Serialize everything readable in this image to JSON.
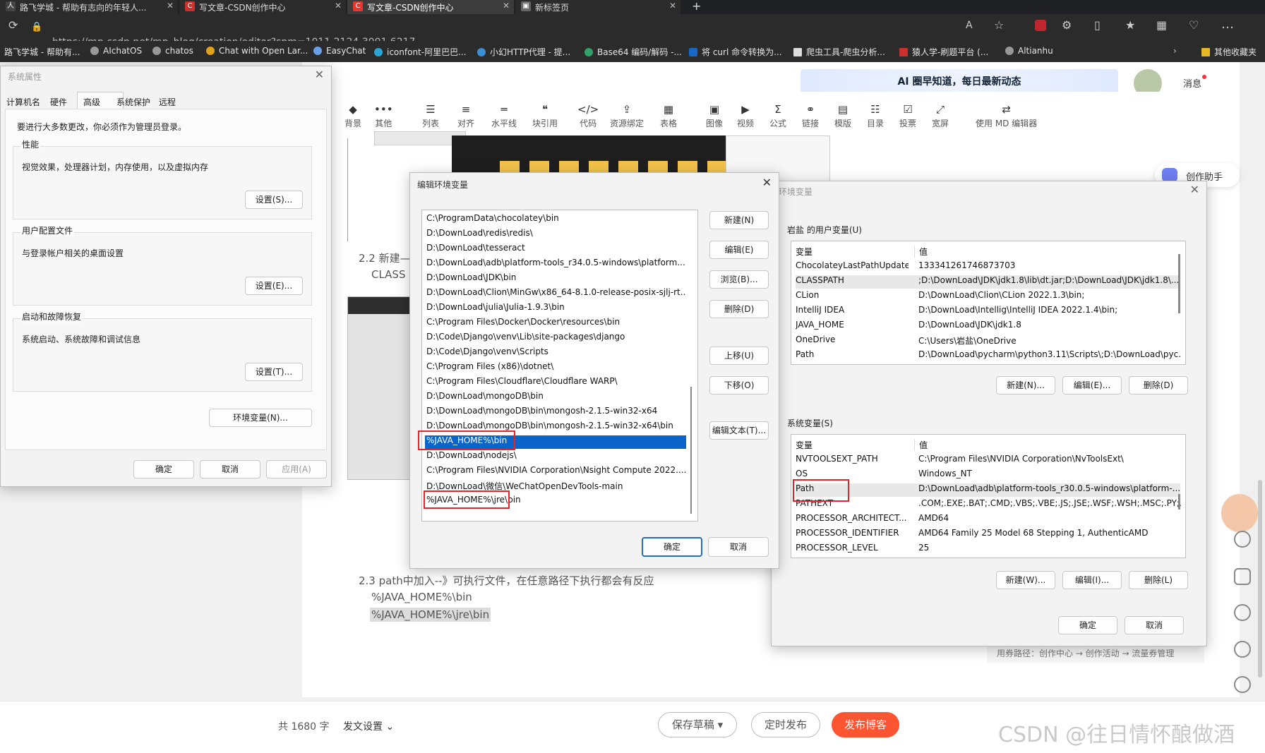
{
  "browser": {
    "tabs": [
      {
        "title": "路飞学城 - 帮助有志向的年轻人..."
      },
      {
        "title": "写文章-CSDN创作中心"
      },
      {
        "title": "写文章-CSDN创作中心"
      },
      {
        "title": "新标签页"
      }
    ],
    "url": "https://mp.csdn.net/mp_blog/creation/editor?spm=1011.2124.3001.6217",
    "bookmarks": [
      "路飞学城 - 帮助有...",
      "AIchatOS",
      "chatos",
      "Chat with Open Lar...",
      "EasyChat",
      "iconfont-阿里巴巴...",
      "小幻HTTP代理 - 提...",
      "Base64 编码/解码 -...",
      "将 curl 命令转换为...",
      "爬虫工具-爬虫分析...",
      "猿人学-刷题平台 (...",
      "Altianhu"
    ],
    "other_bookmarks": "其他收藏夹"
  },
  "editor": {
    "toolbar": [
      "背景",
      "其他",
      "列表",
      "对齐",
      "水平线",
      "块引用",
      "代码",
      "资源绑定",
      "表格",
      "图像",
      "视频",
      "公式",
      "链接",
      "模版",
      "目录",
      "投票",
      "宽屏",
      "使用 MD 编辑器"
    ],
    "banner": "AI 圈早知道，每日最新动态",
    "message_label": "消息",
    "assistant": "创作助手",
    "section_22": "2.2 新建—",
    "classpath_text": "CLASS",
    "section_23": "2.3 path中加入--》可执行文件，在任意路径下执行都会有反应",
    "line1": "%JAVA_HOME%\\bin",
    "line2": "%JAVA_HOME%\\jre\\bin",
    "usage_path": "用券路径：创作中心 → 创作活动 → 流量券管理",
    "word_count": "共 1680 字",
    "publish_settings": "发文设置",
    "save_draft": "保存草稿",
    "scheduled": "定时发布",
    "publish": "发布博客",
    "watermark": "CSDN @往日情怀酿做酒"
  },
  "sysprops": {
    "title": "系统属性",
    "tabs": [
      "计算机名",
      "硬件",
      "高级",
      "系统保护",
      "远程"
    ],
    "admin_note": "要进行大多数更改，你必须作为管理员登录。",
    "perf_label": "性能",
    "perf_desc": "视觉效果，处理器计划，内存使用，以及虚拟内存",
    "perf_btn": "设置(S)...",
    "profile_label": "用户配置文件",
    "profile_desc": "与登录帐户相关的桌面设置",
    "profile_btn": "设置(E)...",
    "startup_label": "启动和故障恢复",
    "startup_desc": "系统启动、系统故障和调试信息",
    "startup_btn": "设置(T)...",
    "envvars_btn": "环境变量(N)...",
    "ok": "确定",
    "cancel": "取消",
    "apply": "应用(A)"
  },
  "editenv": {
    "title": "编辑环境变量",
    "items": [
      "C:\\ProgramData\\chocolatey\\bin",
      "D:\\DownLoad\\redis\\redis\\",
      "D:\\DownLoad\\tesseract",
      "D:\\DownLoad\\adb\\platform-tools_r34.0.5-windows\\platform...",
      "D:\\DownLoad\\JDK\\bin",
      "D:\\DownLoad\\Clion\\MinGw\\x86_64-8.1.0-release-posix-sjlj-rt...",
      "D:\\DownLoad\\julia\\Julia-1.9.3\\bin",
      "C:\\Program Files\\Docker\\Docker\\resources\\bin",
      "D:\\Code\\Django\\venv\\Lib\\site-packages\\django",
      "D:\\Code\\Django\\venv\\Scripts",
      "C:\\Program Files (x86)\\dotnet\\",
      "C:\\Program Files\\Cloudflare\\Cloudflare WARP\\",
      "D:\\DownLoad\\mongoDB\\bin",
      "D:\\DownLoad\\mongoDB\\bin\\mongosh-2.1.5-win32-x64",
      "D:\\DownLoad\\mongoDB\\bin\\mongosh-2.1.5-win32-x64\\bin",
      "%JAVA_HOME%\\bin",
      "D:\\DownLoad\\nodejs\\",
      "C:\\Program Files\\NVIDIA Corporation\\Nsight Compute 2022....",
      "D:\\DownLoad\\微信\\WeChatOpenDevTools-main",
      "%JAVA_HOME%\\jre\\bin"
    ],
    "buttons": [
      "新建(N)",
      "编辑(E)",
      "浏览(B)...",
      "删除(D)",
      "上移(U)",
      "下移(O)",
      "编辑文本(T)..."
    ],
    "ok": "确定",
    "cancel": "取消"
  },
  "envvars": {
    "title": "环境变量",
    "user_label": "岩盐 的用户变量(U)",
    "col_var": "变量",
    "col_val": "值",
    "user_rows": [
      {
        "name": "ChocolateyLastPathUpdate",
        "value": "133341261746873703"
      },
      {
        "name": "CLASSPATH",
        "value": ";D:\\DownLoad\\JDK\\jdk1.8\\lib\\dt.jar;D:\\DownLoad\\JDK\\jdk1.8\\..."
      },
      {
        "name": "CLion",
        "value": "D:\\DownLoad\\Clion\\CLion 2022.1.3\\bin;"
      },
      {
        "name": "IntelliJ IDEA",
        "value": "D:\\DownLoad\\Intellig\\IntelliJ IDEA 2022.1.4\\bin;"
      },
      {
        "name": "JAVA_HOME",
        "value": "D:\\DownLoad\\JDK\\jdk1.8"
      },
      {
        "name": "OneDrive",
        "value": "C:\\Users\\岩盐\\OneDrive"
      },
      {
        "name": "Path",
        "value": "D:\\DownLoad\\pycharm\\python3.11\\Scripts\\;D:\\DownLoad\\pyc..."
      }
    ],
    "user_buttons": [
      "新建(N)...",
      "编辑(E)...",
      "删除(D)"
    ],
    "sys_label": "系统变量(S)",
    "sys_rows": [
      {
        "name": "NVTOOLSEXT_PATH",
        "value": "C:\\Program Files\\NVIDIA Corporation\\NvToolsExt\\"
      },
      {
        "name": "OS",
        "value": "Windows_NT"
      },
      {
        "name": "Path",
        "value": "D:\\DownLoad\\adb\\platform-tools_r30.0.5-windows\\platform-..."
      },
      {
        "name": "PATHEXT",
        "value": ".COM;.EXE;.BAT;.CMD;.VBS;.VBE;.JS;.JSE;.WSF;.WSH;.MSC;.PY;.P..."
      },
      {
        "name": "PROCESSOR_ARCHITECT...",
        "value": "AMD64"
      },
      {
        "name": "PROCESSOR_IDENTIFIER",
        "value": "AMD64 Family 25 Model 68 Stepping 1, AuthenticAMD"
      },
      {
        "name": "PROCESSOR_LEVEL",
        "value": "25"
      }
    ],
    "sys_buttons": [
      "新建(W)...",
      "编辑(I)...",
      "删除(L)"
    ],
    "ok": "确定",
    "cancel": "取消"
  }
}
